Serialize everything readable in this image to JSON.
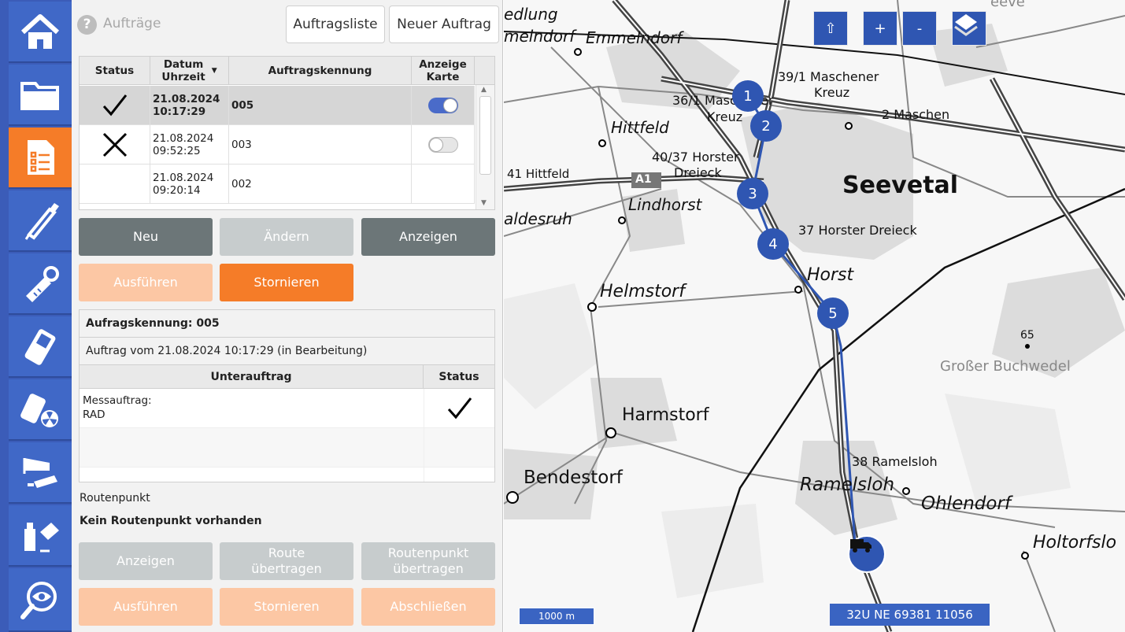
{
  "header": {
    "title": "Aufträge",
    "tab_list": "Auftragsliste",
    "tab_new": "Neuer Auftrag"
  },
  "orders_table": {
    "columns": {
      "status": "Status",
      "datetime": "Datum\nUhrzeit",
      "id": "Auftragskennung",
      "map": "Anzeige\nKarte"
    },
    "rows": [
      {
        "status": "check",
        "date": "21.08.2024",
        "time": "10:17:29",
        "id": "005",
        "map_toggle": "on"
      },
      {
        "status": "cross",
        "date": "21.08.2024",
        "time": "09:52:25",
        "id": "003",
        "map_toggle": "off"
      },
      {
        "status": "",
        "date": "21.08.2024",
        "time": "09:20:14",
        "id": "002",
        "map_toggle": ""
      }
    ]
  },
  "actions": {
    "new": "Neu",
    "edit": "Ändern",
    "show": "Anzeigen",
    "execute": "Ausführen",
    "cancel": "Stornieren"
  },
  "detail": {
    "id_line": "Aufragskennung: 005",
    "desc_line": "Auftrag vom 21.08.2024 10:17:29 (in Bearbeitung)",
    "sub_header": "Unterauftrag",
    "status_header": "Status",
    "sub_rows": [
      {
        "line1": "Messauftrag:",
        "line2": "RAD",
        "status": "check"
      }
    ]
  },
  "route": {
    "label": "Routenpunkt",
    "empty": "Kein Routenpunkt vorhanden",
    "show": "Anzeigen",
    "transfer_route_1": "Route",
    "transfer_route_2": "übertragen",
    "transfer_point_1": "Routenpunkt",
    "transfer_point_2": "übertragen",
    "execute": "Ausführen",
    "cancel": "Stornieren",
    "close": "Abschließen"
  },
  "map": {
    "btn_up": "⇧",
    "btn_plus": "+",
    "btn_minus": "-",
    "scale": "1000 m",
    "coords": "32U NE 69381 11056",
    "labels": {
      "l1": "edlung",
      "l2": "Emmelndorf",
      "l3": "melndorf",
      "l4": "39/1 Maschener",
      "l5": "Kreuz",
      "l6": "36/1 Maschener",
      "l7": "Kreuz",
      "l8": "2 Maschen",
      "l9": "Hittfeld",
      "l10": "40/37 Horster",
      "l11": "Dreieck",
      "l12": "41 Hittfeld",
      "l13": "A1",
      "l14": "Seevetal",
      "l15": "Lindhorst",
      "l16": "aldesruh",
      "l17": "37 Horster Dreieck",
      "l18": "Horst",
      "l19": "Helmstorf",
      "l20": "65",
      "l21": "Großer Buchwedel",
      "l22": "Harmstorf",
      "l23": "38 Ramelsloh",
      "l24": "Bendestorf",
      "l25": "Ramelsloh",
      "l26": "Ohlendorf",
      "l27": "Holtorfslo",
      "l28": "eeve"
    },
    "waypoints": [
      "1",
      "2",
      "3",
      "4",
      "5"
    ]
  }
}
